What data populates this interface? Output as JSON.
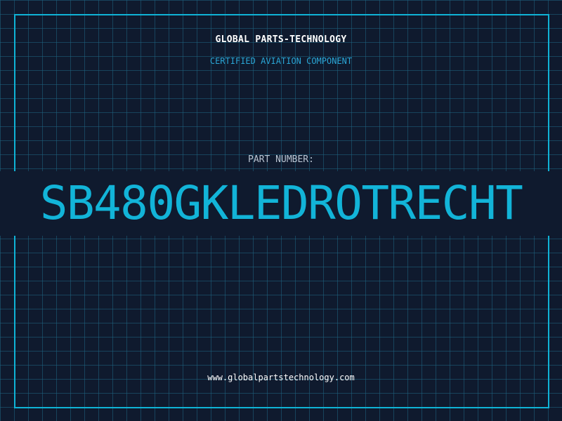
{
  "header": {
    "brand": "GLOBAL PARTS-TECHNOLOGY",
    "subtitle": "CERTIFIED AVIATION COMPONENT"
  },
  "part": {
    "label": "PART NUMBER:",
    "number": "SB480GKLEDROTRECHT"
  },
  "footer": {
    "website": "www.globalpartstechnology.com"
  },
  "colors": {
    "background": "#0f1a2e",
    "grid": "#1e6482",
    "accent": "#12b4d8",
    "subtitle": "#2aa6d6",
    "label": "#b9c4d2",
    "text": "#ffffff"
  }
}
